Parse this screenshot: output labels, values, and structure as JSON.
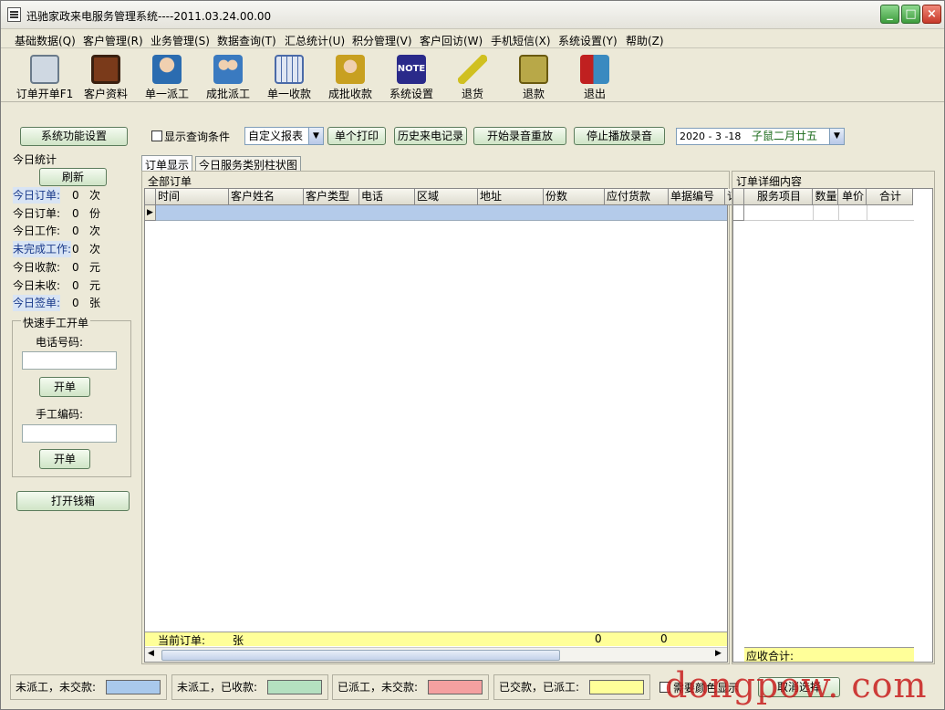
{
  "window": {
    "title": "迅驰家政来电服务管理系统----2011.03.24.00.00"
  },
  "menu": [
    "基础数据(Q)",
    "客户管理(R)",
    "业务管理(S)",
    "数据查询(T)",
    "汇总统计(U)",
    "积分管理(V)",
    "客户回访(W)",
    "手机短信(X)",
    "系统设置(Y)",
    "帮助(Z)"
  ],
  "toolbar": [
    {
      "label": "订单开单F1",
      "icon": "calendar-icon",
      "color": "#6a7a8a"
    },
    {
      "label": "客户资料",
      "icon": "tv-icon",
      "color": "#7a3a1a"
    },
    {
      "label": "单一派工",
      "icon": "person-dispatch-icon",
      "color": "#2b6cb0"
    },
    {
      "label": "成批派工",
      "icon": "group-dispatch-icon",
      "color": "#3a7ac0"
    },
    {
      "label": "单一收款",
      "icon": "keyboard-icon",
      "color": "#4a6aa8"
    },
    {
      "label": "成批收款",
      "icon": "batch-collect-icon",
      "color": "#c8a020"
    },
    {
      "label": "系统设置",
      "icon": "note-icon",
      "color": "#2a2a8a"
    },
    {
      "label": "退货",
      "icon": "pencil-icon",
      "color": "#d0c020"
    },
    {
      "label": "退款",
      "icon": "leaf-icon",
      "color": "#8a7a20"
    },
    {
      "label": "退出",
      "icon": "exit-door-icon",
      "color": "#c02020"
    }
  ],
  "controls": {
    "sys_func_btn": "系统功能设置",
    "show_query": "显示查询条件",
    "report_select": "自定义报表",
    "print_btn": "单个打印",
    "history_btn": "历史来电记录",
    "record_btn": "开始录音重放",
    "stop_btn": "停止播放录音",
    "date": "2020 - 3 -18",
    "lunar": "子鼠二月廿五"
  },
  "today_stats": {
    "title": "今日统计",
    "refresh": "刷新",
    "rows": [
      {
        "label": "今日订单:",
        "value": "0",
        "unit": "次",
        "highlight": true
      },
      {
        "label": "今日订单:",
        "value": "0",
        "unit": "份",
        "highlight": false
      },
      {
        "label": "今日工作:",
        "value": "0",
        "unit": "次",
        "highlight": false
      },
      {
        "label": "未完成工作:",
        "value": "0",
        "unit": "次",
        "highlight": true
      },
      {
        "label": "今日收款:",
        "value": "0",
        "unit": "元",
        "highlight": false
      },
      {
        "label": "今日未收:",
        "value": "0",
        "unit": "元",
        "highlight": false
      },
      {
        "label": "今日签单:",
        "value": "0",
        "unit": "张",
        "highlight": true
      }
    ]
  },
  "quick_order": {
    "title": "快速手工开单",
    "phone_label": "电话号码:",
    "open1": "开单",
    "code_label": "手工编码:",
    "open2": "开单",
    "cashbox": "打开钱箱"
  },
  "tabs": [
    "订单显示",
    "今日服务类别柱状图"
  ],
  "orders": {
    "title": "全部订单",
    "columns": [
      "时间",
      "客户姓名",
      "客户类型",
      "电话",
      "区域",
      "地址",
      "份数",
      "应付货款",
      "单据编号",
      "订"
    ],
    "footer": {
      "label": "当前订单:",
      "unit": "张",
      "qty": "0",
      "amount": "0"
    }
  },
  "detail": {
    "title": "订单详细内容",
    "columns": [
      "服务项目",
      "数量",
      "单价",
      "合计"
    ],
    "footer_label": "应收合计:"
  },
  "legend": [
    {
      "label": "未派工，未交款:",
      "color": "#a9c9ec"
    },
    {
      "label": "未派工，已收款:",
      "color": "#b4e0c0"
    },
    {
      "label": "已派工，未交款:",
      "color": "#f4a0a0"
    },
    {
      "label": "已交款，已派工:",
      "color": "#ffff99"
    }
  ],
  "bottom": {
    "color_display": "需要颜色显示",
    "cancel": "取消选择"
  },
  "watermark": "dongpow. com"
}
